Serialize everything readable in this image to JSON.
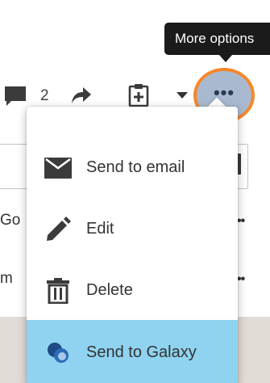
{
  "background": {
    "row_1_text": "Go",
    "row_2_text": "m",
    "row_dots": "••"
  },
  "toolbar": {
    "comment_count": "2",
    "more_button_glyph": "•••",
    "tooltip": "More options"
  },
  "menu": {
    "items": [
      {
        "label": "Send to email",
        "icon": "envelope-icon"
      },
      {
        "label": "Edit",
        "icon": "pencil-icon"
      },
      {
        "label": "Delete",
        "icon": "trash-icon"
      },
      {
        "label": "Send to Galaxy",
        "icon": "galaxy-icon"
      }
    ],
    "highlight_color": "#8fd3f0"
  },
  "colors": {
    "focus_ring": "#f7872b",
    "more_button_fill": "#a9bad0"
  }
}
